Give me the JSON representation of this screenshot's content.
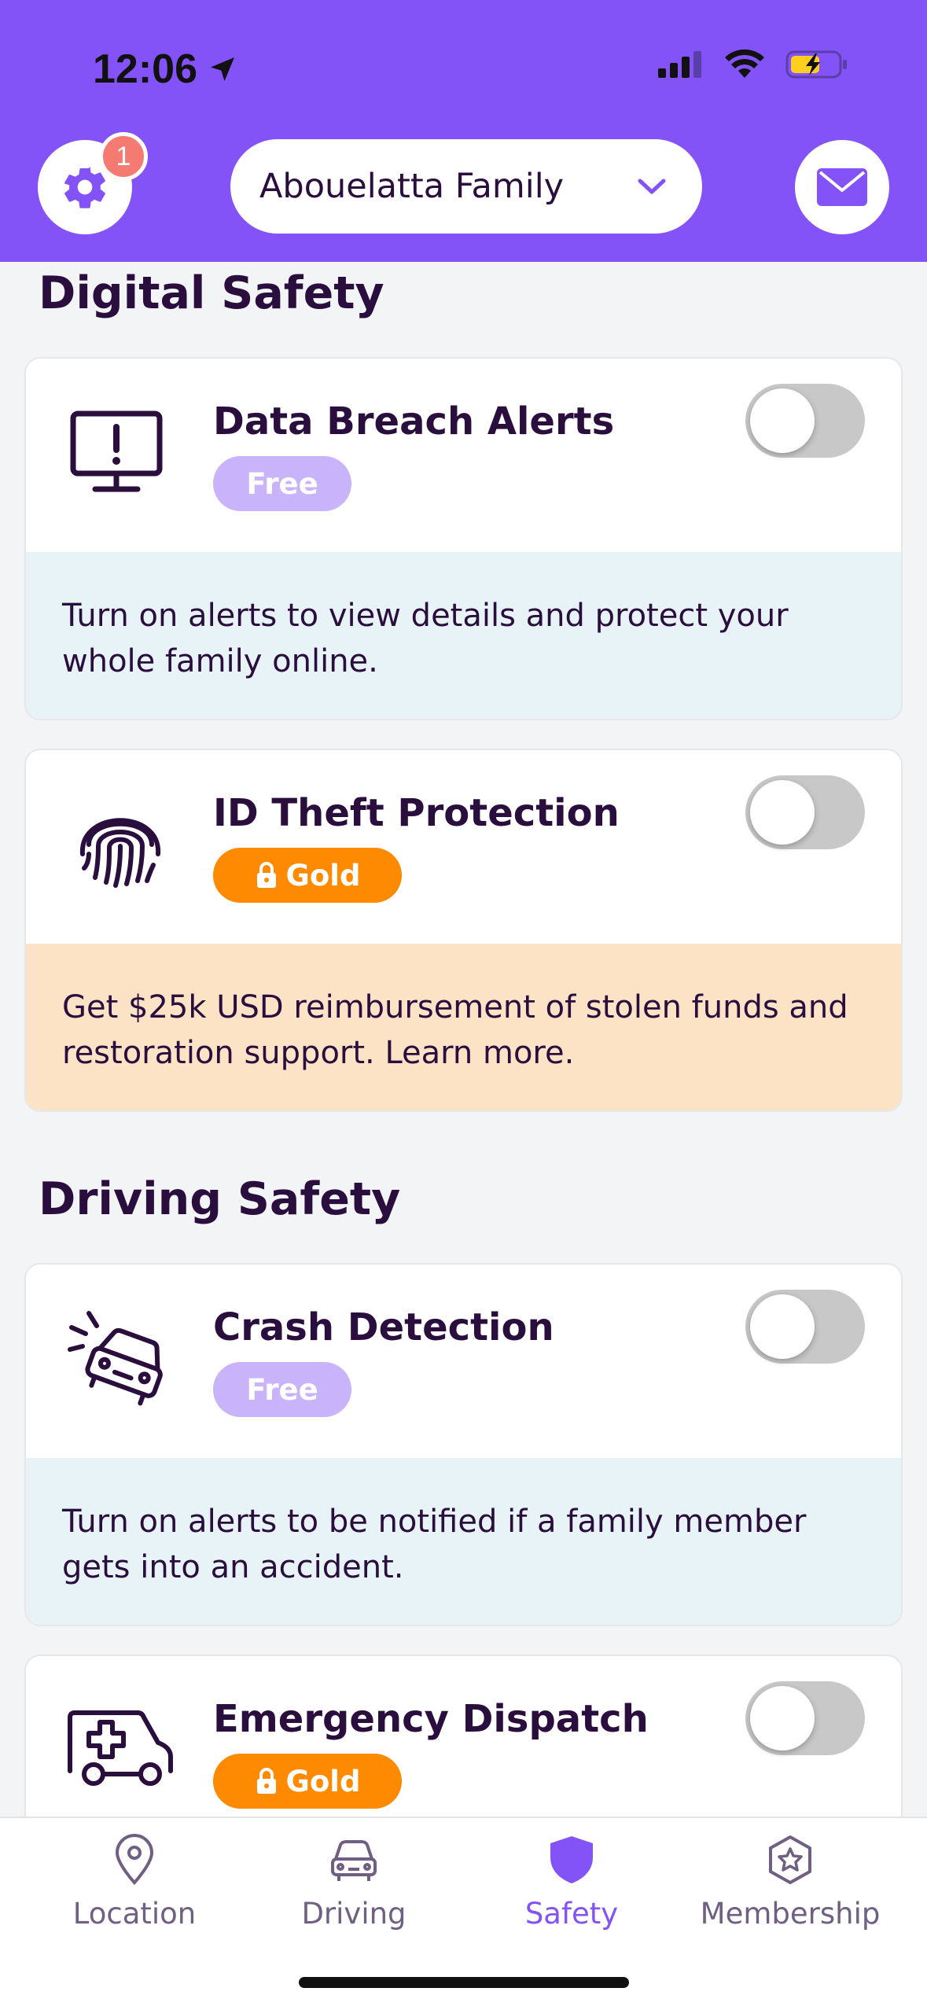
{
  "status_bar": {
    "time": "12:06"
  },
  "header": {
    "notification_count": "1",
    "family_name": "Abouelatta Family"
  },
  "sections": [
    {
      "title": "Digital Safety"
    },
    {
      "title": "Driving Safety"
    }
  ],
  "cards": [
    {
      "title": "Data Breach Alerts",
      "badge": "Free",
      "toggle_on": false,
      "description": "Turn on alerts to view details and protect your whole family online."
    },
    {
      "title": "ID Theft Protection",
      "badge": "Gold",
      "toggle_on": false,
      "description": "Get $25k USD reimbursement of stolen funds and restoration support. Learn more."
    },
    {
      "title": "Crash Detection",
      "badge": "Free",
      "toggle_on": false,
      "description": "Turn on alerts to be notified if a family member gets into an accident."
    },
    {
      "title": "Emergency Dispatch",
      "badge": "Gold",
      "toggle_on": false
    }
  ],
  "tabs": [
    {
      "label": "Location",
      "icon": "location-pin-icon"
    },
    {
      "label": "Driving",
      "icon": "car-icon"
    },
    {
      "label": "Safety",
      "icon": "shield-icon",
      "active": true
    },
    {
      "label": "Membership",
      "icon": "star-badge-icon"
    }
  ],
  "colors": {
    "header_purple": "#8353f7",
    "gold": "#fd8a00",
    "free_pill": "#c9b3fb",
    "dark_text": "#2a0e3d"
  }
}
